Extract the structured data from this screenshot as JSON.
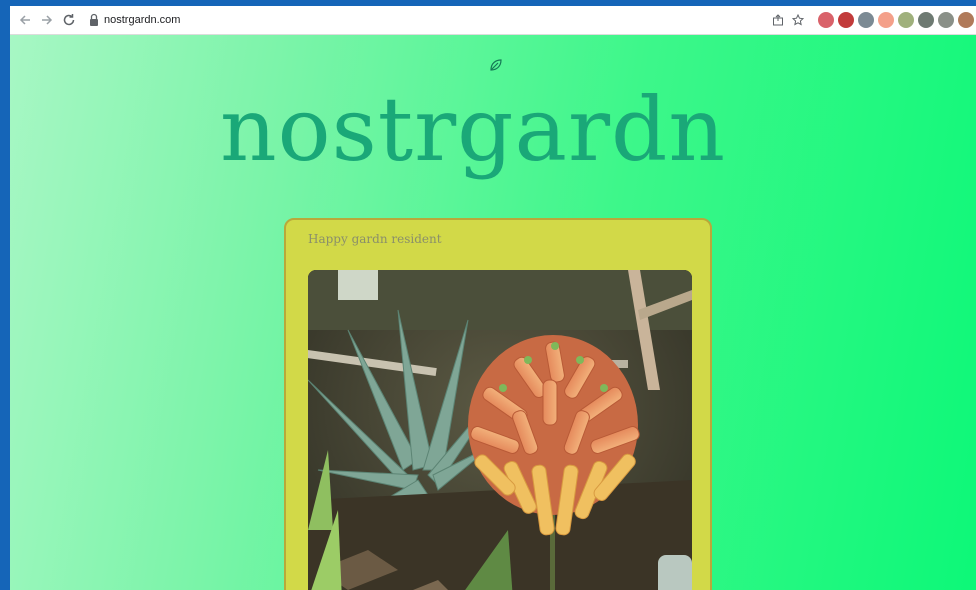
{
  "browser": {
    "url": "nostrgardn.com",
    "back_icon": "back-arrow-icon",
    "forward_icon": "forward-arrow-icon",
    "reload_icon": "reload-icon"
  },
  "site": {
    "title": "nostrgardn",
    "logo_icon": "leaf-icon"
  },
  "post": {
    "caption": "Happy gardn resident",
    "image_description": "aloe-flower-photo"
  },
  "colors": {
    "accent": "#1aa878",
    "card": "#d2d948",
    "background_start": "#a7f7c4",
    "background_end": "#0df878"
  }
}
